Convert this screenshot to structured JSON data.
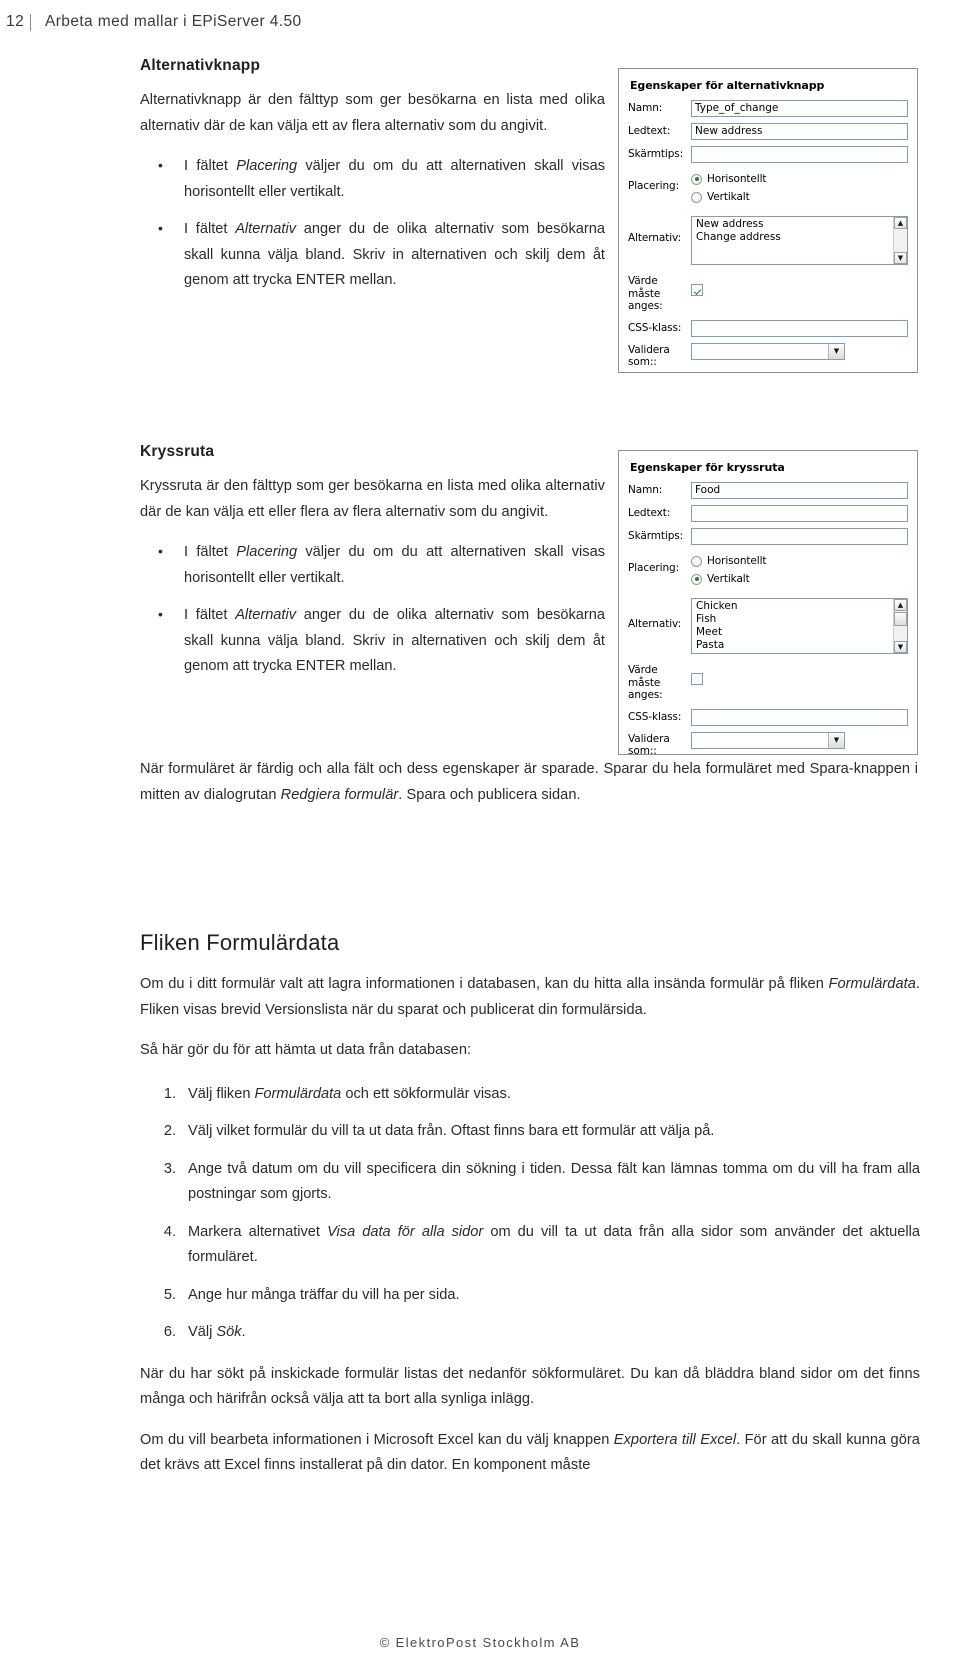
{
  "header": {
    "page_number": "12",
    "title": "Arbeta med mallar i EPiServer 4.50"
  },
  "footer": {
    "copyright": "© ElektroPost Stockholm AB"
  },
  "sections": {
    "radio": {
      "heading": "Alternativknapp",
      "intro": "Alternativknapp är den fälttyp som ger besökarna en lista med olika alternativ där de kan välja ett av flera alternativ som du angivit.",
      "bullets": [
        {
          "pre": "I fältet ",
          "em": "Placering",
          "post": " väljer du om du att alternativen skall visas horisontellt eller vertikalt."
        },
        {
          "pre": "I fältet ",
          "em": "Alternativ",
          "post": " anger du de olika alternativ som besökarna skall kunna välja bland. Skriv in alternativen och skilj dem åt genom att trycka ENTER mellan."
        }
      ]
    },
    "checkbox": {
      "heading": "Kryssruta",
      "intro": "Kryssruta är den fälttyp som ger besökarna en lista med olika alternativ där de kan välja ett eller flera av flera alternativ som du angivit.",
      "bullets": [
        {
          "pre": "I fältet ",
          "em": "Placering",
          "post": " väljer du om du att alternativen skall visas horisontellt eller vertikalt."
        },
        {
          "pre": "I fältet ",
          "em": "Alternativ",
          "post": " anger du de olika alternativ som besökarna skall kunna välja bland. Skriv in alternativen och skilj dem åt genom att trycka ENTER mellan."
        }
      ],
      "closing": {
        "pre": "När formuläret är färdig och alla fält och dess egenskaper är sparade. Sparar du hela formuläret med Spara-knappen i mitten av dialogrutan ",
        "em": "Redgiera formulär",
        "post": ". Spara och publicera sidan."
      }
    },
    "formdata": {
      "heading": "Fliken Formulärdata",
      "intro": {
        "pre": "Om du i ditt formulär valt att lagra informationen i databasen, kan du hitta alla insända formulär på fliken ",
        "em": "Formulärdata",
        "post": ". Fliken visas brevid Versionslista när du sparat och publicerat din formulärsida."
      },
      "lead": "Så här gör du för att hämta ut data från databasen:",
      "steps": [
        {
          "num": "1.",
          "pre": "Välj fliken ",
          "em": "Formulärdata",
          "post": " och ett sökformulär visas."
        },
        {
          "num": "2.",
          "pre": "Välj vilket formulär du vill ta ut data från. Oftast finns bara ett formulär att välja på.",
          "em": "",
          "post": ""
        },
        {
          "num": "3.",
          "pre": "Ange två datum om du vill specificera din sökning i tiden. Dessa fält kan lämnas tomma om du vill ha fram alla postningar som gjorts.",
          "em": "",
          "post": ""
        },
        {
          "num": "4.",
          "pre": "Markera alternativet ",
          "em": "Visa data för alla sidor",
          "post": " om du vill ta ut data från alla sidor som använder det aktuella formuläret."
        },
        {
          "num": "5.",
          "pre": "Ange hur många träffar du vill ha per sida.",
          "em": "",
          "post": ""
        },
        {
          "num": "6.",
          "pre": "Välj ",
          "em": "Sök",
          "post": "."
        }
      ],
      "para_search": "När du har sökt på inskickade formulär listas det nedanför sökformuläret. Du kan då bläddra bland sidor om det finns många och härifrån också välja att ta bort alla synliga inlägg.",
      "para_excel": {
        "pre": "Om du vill bearbeta informationen i Microsoft Excel kan du välj knappen ",
        "em": "Exportera till Excel",
        "post": ". För att du skall kunna göra det krävs att Excel finns installerat på din dator. En komponent måste"
      }
    }
  },
  "screenshots": {
    "radio_panel": {
      "title": "Egenskaper för alternativknapp",
      "fields": {
        "namn_label": "Namn:",
        "namn_value": "Type_of_change",
        "ledtext_label": "Ledtext:",
        "ledtext_value": "New address",
        "skarmtips_label": "Skärmtips:",
        "skarmtips_value": "",
        "placering_label": "Placering:",
        "placering_options": [
          "Horisontellt",
          "Vertikalt"
        ],
        "placering_selected": "Horisontellt",
        "alternativ_label": "Alternativ:",
        "alternativ_options": [
          "New address",
          "Change address"
        ],
        "varde_label": "Värde måste anges:",
        "varde_checked": true,
        "css_label": "CSS-klass:",
        "css_value": "",
        "validera_label": "Validera som::",
        "validera_value": ""
      }
    },
    "checkbox_panel": {
      "title": "Egenskaper för kryssruta",
      "fields": {
        "namn_label": "Namn:",
        "namn_value": "Food",
        "ledtext_label": "Ledtext:",
        "ledtext_value": "",
        "skarmtips_label": "Skärmtips:",
        "skarmtips_value": "",
        "placering_label": "Placering:",
        "placering_options": [
          "Horisontellt",
          "Vertikalt"
        ],
        "placering_selected": "Vertikalt",
        "alternativ_label": "Alternativ:",
        "alternativ_options": [
          "Chicken",
          "Fish",
          "Meet",
          "Pasta"
        ],
        "varde_label": "Värde måste anges:",
        "varde_checked": false,
        "css_label": "CSS-klass:",
        "css_value": "",
        "validera_label": "Validera som::",
        "validera_value": ""
      }
    },
    "scroll_up_glyph": "▲",
    "scroll_down_glyph": "▼",
    "combo_arrow_glyph": "▼"
  }
}
